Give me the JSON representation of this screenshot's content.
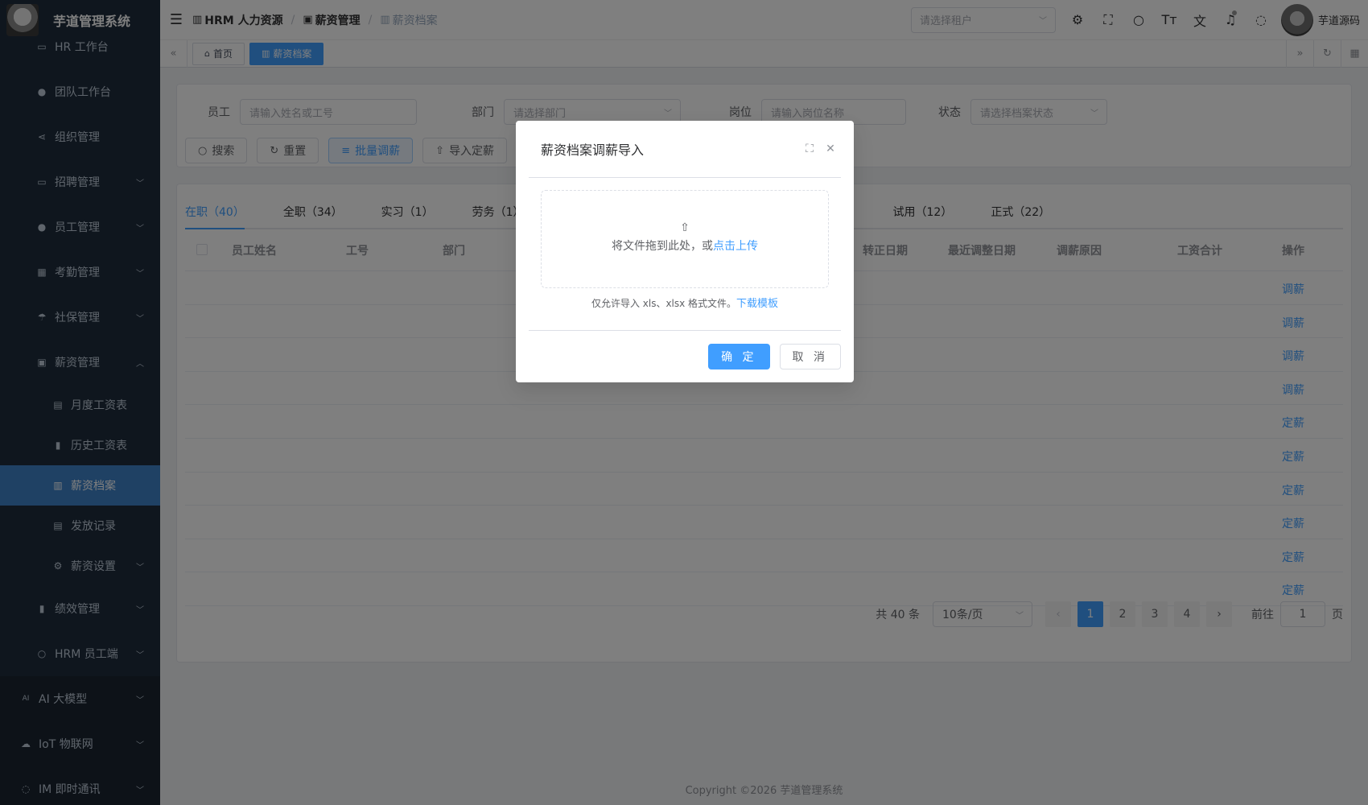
{
  "app": {
    "title": "芋道管理系统"
  },
  "sidebar": {
    "items": [
      {
        "label": "HR 工作台",
        "icon": "monitor-icon"
      },
      {
        "label": "团队工作台",
        "icon": "user-icon"
      },
      {
        "label": "组织管理",
        "icon": "share-icon"
      },
      {
        "label": "招聘管理",
        "icon": "briefcase-icon",
        "expandable": true
      },
      {
        "label": "员工管理",
        "icon": "user-icon",
        "expandable": true
      },
      {
        "label": "考勤管理",
        "icon": "calendar-icon",
        "expandable": true
      },
      {
        "label": "社保管理",
        "icon": "umbrella-icon",
        "expandable": true
      },
      {
        "label": "薪资管理",
        "icon": "money-icon",
        "expanded": true
      }
    ],
    "salary_children": [
      {
        "label": "月度工资表",
        "icon": "document-icon"
      },
      {
        "label": "历史工资表",
        "icon": "bar-chart-icon"
      },
      {
        "label": "薪资档案",
        "icon": "folder-icon",
        "active": true
      },
      {
        "label": "发放记录",
        "icon": "list-icon"
      },
      {
        "label": "薪资设置",
        "icon": "gear-icon",
        "expandable": true
      }
    ],
    "after_items": [
      {
        "label": "绩效管理",
        "icon": "bar-chart-icon"
      },
      {
        "label": "HRM 员工端",
        "icon": "user-icon"
      }
    ],
    "top_items": [
      {
        "label": "AI 大模型",
        "icon": "ai-icon"
      },
      {
        "label": "IoT 物联网",
        "icon": "cloud-icon"
      },
      {
        "label": "IM 即时通讯",
        "icon": "chat-icon"
      }
    ]
  },
  "navbar": {
    "breadcrumb": [
      "HRM 人力资源",
      "薪资管理",
      "薪资档案"
    ],
    "tenant_placeholder": "请选择租户",
    "user_name": "芋道源码"
  },
  "tags": {
    "home": "首页",
    "current": "薪资档案"
  },
  "search": {
    "employee_label": "员工",
    "employee_placeholder": "请输入姓名或工号",
    "dept_label": "部门",
    "dept_placeholder": "请选择部门",
    "post_label": "岗位",
    "post_placeholder": "请输入岗位名称",
    "status_label": "状态",
    "status_placeholder": "请选择档案状态",
    "btn_search": "搜索",
    "btn_reset": "重置",
    "btn_batch": "批量调薪",
    "btn_import": "导入定薪"
  },
  "tabs": [
    {
      "label": "在职（40）",
      "active": true
    },
    {
      "label": "全职（34）"
    },
    {
      "label": "实习（1）"
    },
    {
      "label": "劳务（1）"
    },
    {
      "label": "试用（12）"
    },
    {
      "label": "正式（22）"
    }
  ],
  "table": {
    "columns": [
      "员工姓名",
      "工号",
      "部门",
      "转正日期",
      "最近调整日期",
      "调薪原因",
      "工资合计",
      "操作"
    ],
    "row_actions": [
      "调薪",
      "调薪",
      "调薪",
      "调薪",
      "定薪",
      "定薪",
      "定薪",
      "定薪",
      "定薪",
      "定薪"
    ]
  },
  "pagination": {
    "total": "共 40 条",
    "page_size": "10条/页",
    "pages": [
      "1",
      "2",
      "3",
      "4"
    ],
    "current": "1",
    "goto_label": "前往",
    "goto_value": "1",
    "page_suffix": "页"
  },
  "footer": {
    "copyright": "Copyright ©2026 芋道管理系统"
  },
  "dialog": {
    "title": "薪资档案调薪导入",
    "upload_text": "将文件拖到此处，或",
    "upload_link": "点击上传",
    "tip": "仅允许导入 xls、xlsx 格式文件。",
    "tip_link": "下载模板",
    "confirm": "确 定",
    "cancel": "取 消"
  },
  "colors": {
    "primary": "#409eff",
    "sidebar_bg": "#1f2d3d",
    "sidebar_active": "#3f83c8"
  }
}
